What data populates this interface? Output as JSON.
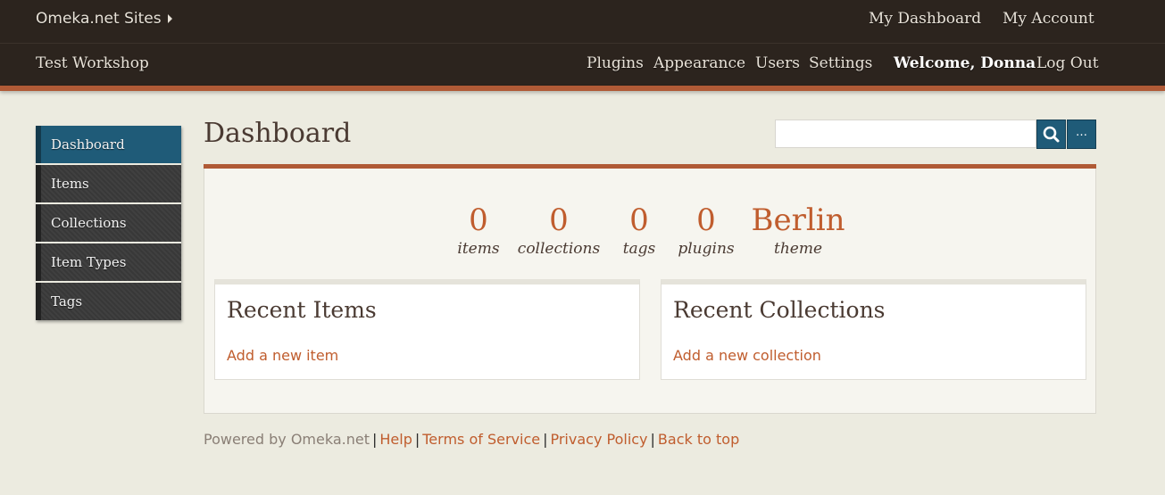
{
  "topnav": {
    "sites_label": "Omeka.net Sites",
    "my_dashboard": "My Dashboard",
    "my_account": "My Account"
  },
  "sitenav": {
    "site_title": "Test Workshop",
    "plugins": "Plugins",
    "appearance": "Appearance",
    "users": "Users",
    "settings": "Settings",
    "welcome": "Welcome, Donna",
    "logout": "Log Out"
  },
  "sidebar": {
    "items": [
      {
        "label": "Dashboard",
        "active": true
      },
      {
        "label": "Items",
        "active": false
      },
      {
        "label": "Collections",
        "active": false
      },
      {
        "label": "Item Types",
        "active": false
      },
      {
        "label": "Tags",
        "active": false
      }
    ]
  },
  "page": {
    "title": "Dashboard"
  },
  "search": {
    "value": "",
    "placeholder": "",
    "search_icon": "search-icon",
    "advanced_label": "…"
  },
  "stats": [
    {
      "value": "0",
      "label": "items"
    },
    {
      "value": "0",
      "label": "collections"
    },
    {
      "value": "0",
      "label": "tags"
    },
    {
      "value": "0",
      "label": "plugins"
    },
    {
      "value": "Berlin",
      "label": "theme"
    }
  ],
  "recent_items": {
    "title": "Recent Items",
    "link": "Add a new item"
  },
  "recent_collections": {
    "title": "Recent Collections",
    "link": "Add a new collection"
  },
  "footer": {
    "powered_by": "Powered by Omeka.net",
    "help": "Help",
    "terms": "Terms of Service",
    "privacy": "Privacy Policy",
    "back_to_top": "Back to top"
  },
  "colors": {
    "header_bg": "#2c241e",
    "accent": "#b05a36",
    "link": "#c05d2e",
    "active_nav": "#1f5b78"
  }
}
